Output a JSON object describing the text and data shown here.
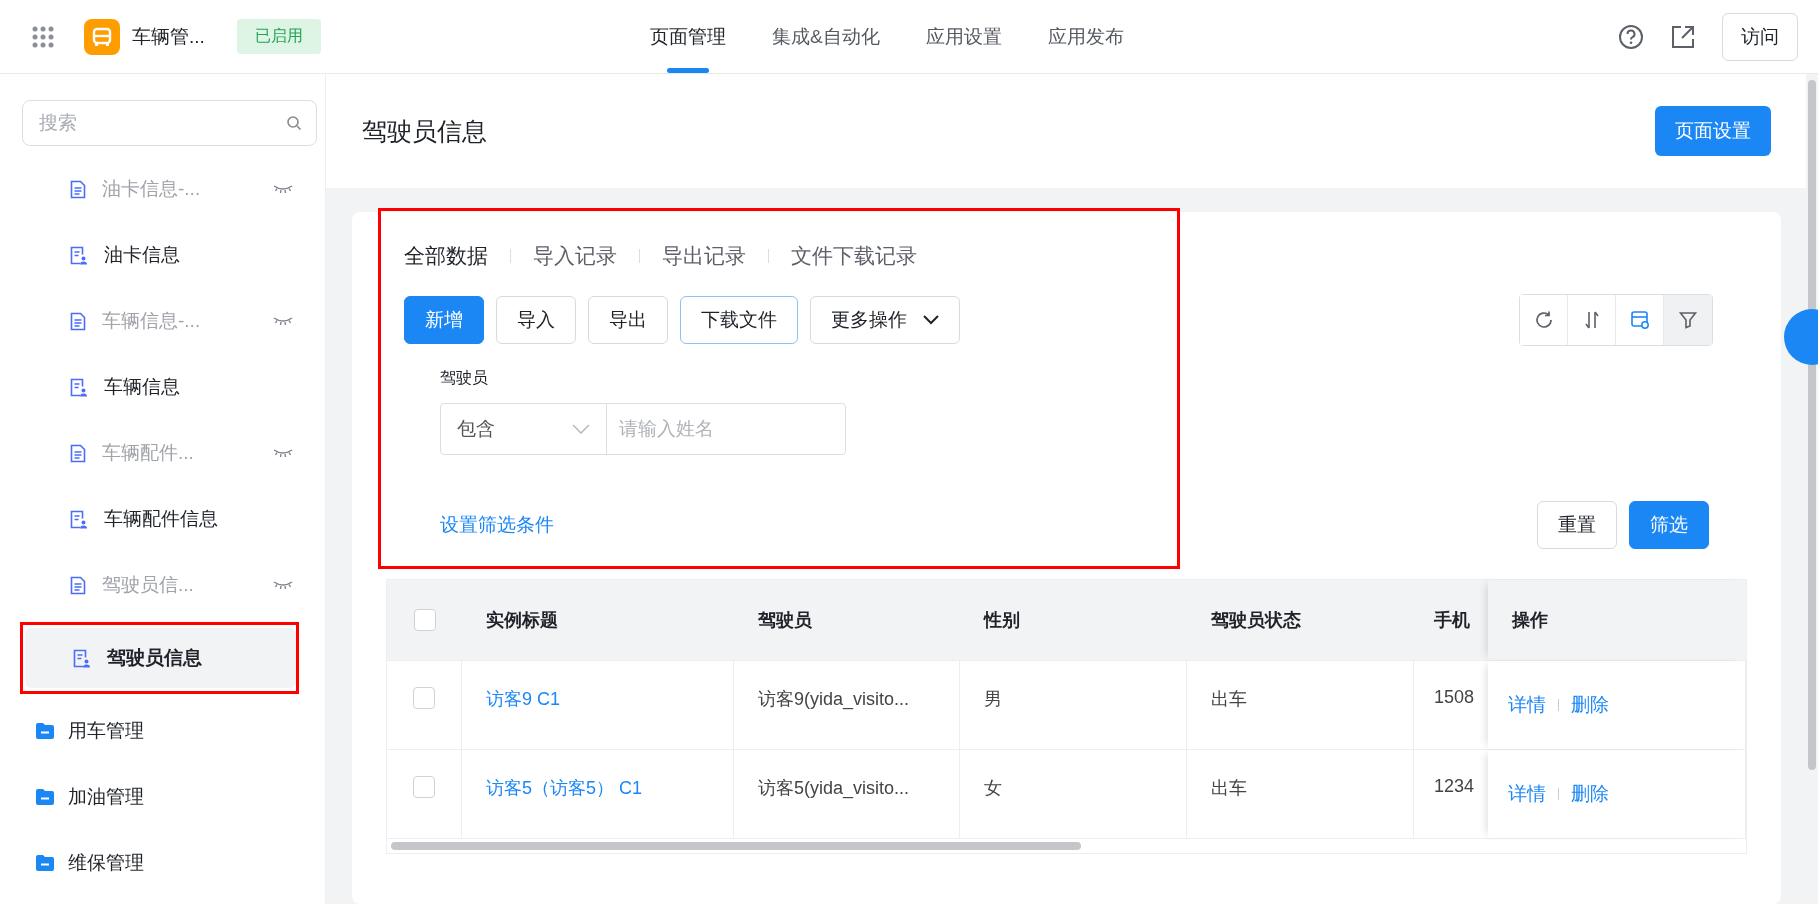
{
  "app": {
    "name": "车辆管...",
    "status": "已启用"
  },
  "nav_tabs": [
    {
      "label": "页面管理",
      "selected": true
    },
    {
      "label": "集成&自动化",
      "selected": false
    },
    {
      "label": "应用设置",
      "selected": false
    },
    {
      "label": "应用发布",
      "selected": false
    }
  ],
  "visit_button": "访问",
  "sidebar": {
    "search": {
      "placeholder": "搜索"
    },
    "items": [
      {
        "kind": "page",
        "label": "油卡信息-...",
        "hidden": true,
        "selected": false
      },
      {
        "kind": "page",
        "label": "油卡信息",
        "hidden": false,
        "selected": false
      },
      {
        "kind": "page",
        "label": "车辆信息-...",
        "hidden": true,
        "selected": false
      },
      {
        "kind": "page",
        "label": "车辆信息",
        "hidden": false,
        "selected": false
      },
      {
        "kind": "page",
        "label": "车辆配件...",
        "hidden": true,
        "selected": false
      },
      {
        "kind": "page",
        "label": "车辆配件信息",
        "hidden": false,
        "selected": false
      },
      {
        "kind": "page",
        "label": "驾驶员信...",
        "hidden": true,
        "selected": false
      },
      {
        "kind": "page",
        "label": "驾驶员信息",
        "hidden": false,
        "selected": true
      },
      {
        "kind": "folder",
        "label": "用车管理",
        "hidden": false,
        "selected": false
      },
      {
        "kind": "folder",
        "label": "加油管理",
        "hidden": false,
        "selected": false
      },
      {
        "kind": "folder",
        "label": "维保管理",
        "hidden": false,
        "selected": false
      }
    ]
  },
  "page": {
    "title": "驾驶员信息",
    "settings_button": "页面设置"
  },
  "data_tabs": [
    {
      "label": "全部数据",
      "selected": true
    },
    {
      "label": "导入记录",
      "selected": false
    },
    {
      "label": "导出记录",
      "selected": false
    },
    {
      "label": "文件下载记录",
      "selected": false
    }
  ],
  "actions": [
    {
      "label": "新增",
      "kind": "primary"
    },
    {
      "label": "导入",
      "kind": "default"
    },
    {
      "label": "导出",
      "kind": "default"
    },
    {
      "label": "下载文件",
      "kind": "outline"
    },
    {
      "label": "更多操作",
      "kind": "dropdown"
    }
  ],
  "filter": {
    "label": "驾驶员",
    "operator": "包含",
    "placeholder": "请输入姓名",
    "set_conditions": "设置筛选条件",
    "reset": "重置",
    "submit": "筛选"
  },
  "table": {
    "select_all": {
      "checked": false
    },
    "columns": [
      "实例标题",
      "驾驶员",
      "性别",
      "驾驶员状态",
      "手机",
      "操作"
    ],
    "rows": [
      {
        "checked": false,
        "cells": [
          "访客9 C1",
          "访客9(yida_visito...",
          "男",
          "出车",
          "1508"
        ],
        "actions": [
          "详情",
          "删除"
        ]
      },
      {
        "checked": false,
        "cells": [
          "访客5（访客5） C1",
          "访客5(yida_visito...",
          "女",
          "出车",
          "1234"
        ],
        "actions": [
          "详情",
          "删除"
        ]
      }
    ]
  }
}
